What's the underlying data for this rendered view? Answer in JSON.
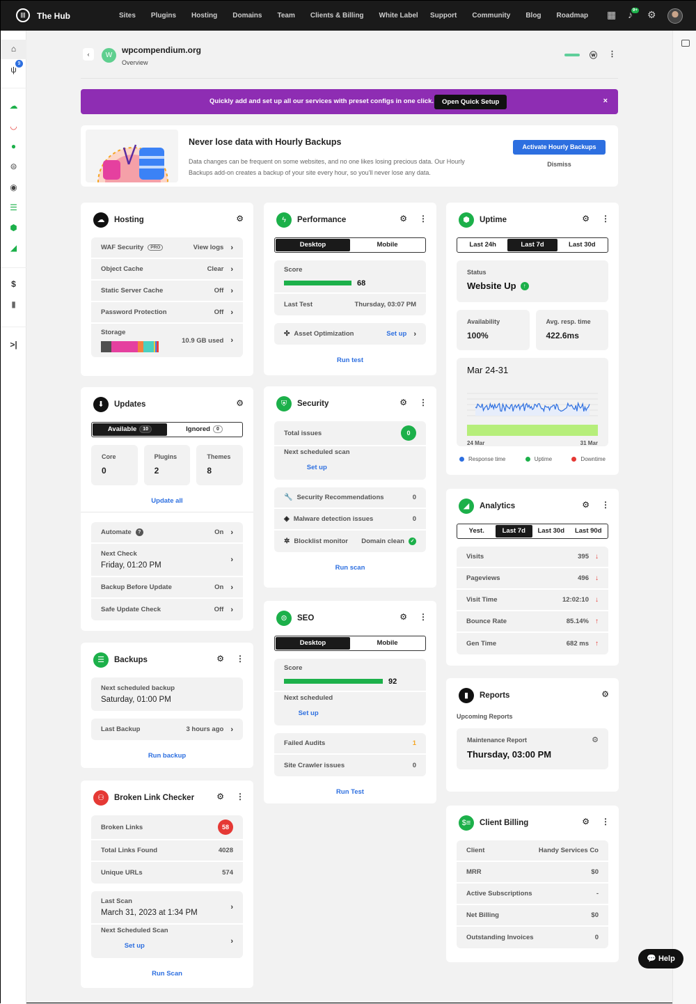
{
  "topnav": {
    "brand": "The Hub",
    "items": [
      "Sites",
      "Plugins",
      "Hosting",
      "Domains",
      "Team",
      "Clients & Billing",
      "White Label"
    ],
    "items_right": [
      "Support",
      "Community",
      "Blog",
      "Roadmap"
    ],
    "notification_count": "9+"
  },
  "sidebar": {
    "plugins_badge": "9"
  },
  "site": {
    "avatar_letter": "W",
    "name": "wpcompendium.org",
    "subtitle": "Overview"
  },
  "banner": {
    "text": "Quickly add and set up all our services with preset configs in one click.",
    "button": "Open Quick Setup",
    "close": "×",
    "color": "#8e2db3"
  },
  "promo": {
    "title": "Never lose data with Hourly Backups",
    "description": "Data changes can be frequent on some websites, and no one likes losing precious data. Our Hourly Backups add-on creates a backup of your site every hour, so you'll never lose any data.",
    "button": "Activate Hourly Backups",
    "dismiss": "Dismiss"
  },
  "columns": [
    {
      "cards": [
        {
          "title": "Hosting",
          "icon": "cloud-icon",
          "icon_color": "#111111",
          "gear": true,
          "more": false,
          "sections": [
            {
              "type": "rows",
              "rows": [
                {
                  "label": "WAF Security",
                  "pro": "PRO",
                  "value": "View logs",
                  "chevron": true
                },
                {
                  "label": "Object Cache",
                  "value": "Clear",
                  "chevron": true
                },
                {
                  "label": "Static Server Cache",
                  "value": "Off",
                  "chevron": true
                },
                {
                  "label": "Password Protection",
                  "value": "Off",
                  "chevron": true
                },
                {
                  "label": "Storage",
                  "value": "10.9 GB used",
                  "chevron": true,
                  "storage": [
                    {
                      "color": "#4f4f4f",
                      "pct": 18
                    },
                    {
                      "color": "#e5409f",
                      "pct": 46
                    },
                    {
                      "color": "#f5803e",
                      "pct": 9
                    },
                    {
                      "color": "#4ad0c0",
                      "pct": 19
                    },
                    {
                      "color": "#f0c93a",
                      "pct": 2
                    },
                    {
                      "color": "#3b82f6",
                      "pct": 2
                    },
                    {
                      "color": "#e94040",
                      "pct": 4
                    }
                  ]
                }
              ]
            }
          ]
        },
        {
          "title": "Updates",
          "icon": "updates-icon",
          "icon_color": "#111111",
          "gear": true,
          "more": false,
          "sections": [
            {
              "type": "tabs",
              "active": 0,
              "items": [
                {
                  "label": "Available",
                  "badge": "10"
                },
                {
                  "label": "Ignored",
                  "badge": "0"
                }
              ]
            },
            {
              "type": "tiles",
              "items": [
                {
                  "label": "Core",
                  "value": "0"
                },
                {
                  "label": "Plugins",
                  "value": "2"
                },
                {
                  "label": "Themes",
                  "value": "8"
                }
              ]
            },
            {
              "type": "link",
              "text": "Update all"
            },
            {
              "type": "divider"
            },
            {
              "type": "rows",
              "rows": [
                {
                  "label": "Automate",
                  "help": true,
                  "value": "On",
                  "chevron": true
                },
                {
                  "label": "Next Check",
                  "sub": "Friday, 01:20 PM",
                  "chevron": true
                },
                {
                  "label": "Backup Before Update",
                  "value": "On",
                  "chevron": true
                },
                {
                  "label": "Safe Update Check",
                  "value": "Off",
                  "chevron": true
                }
              ]
            }
          ]
        },
        {
          "title": "Backups",
          "icon": "backups-icon",
          "icon_color": "#1cb04a",
          "gear": true,
          "more": true,
          "sections": [
            {
              "type": "rows",
              "rows": [
                {
                  "label": "Next scheduled backup",
                  "sub": "Saturday, 01:00 PM"
                }
              ]
            },
            {
              "type": "rows",
              "rows": [
                {
                  "label": "Last Backup",
                  "value": "3 hours ago",
                  "chevron": true
                }
              ]
            },
            {
              "type": "link",
              "text": "Run backup"
            }
          ]
        },
        {
          "title": "Broken Link Checker",
          "icon": "broken-link-icon",
          "icon_color": "#e53935",
          "gear": true,
          "more": true,
          "sections": [
            {
              "type": "rows",
              "rows": [
                {
                  "label": "Broken Links",
                  "value_badge": "58",
                  "badge_color": "#e53935"
                },
                {
                  "label": "Total Links Found",
                  "value": "4028"
                },
                {
                  "label": "Unique URLs",
                  "value": "574"
                }
              ]
            },
            {
              "type": "rows",
              "rows": [
                {
                  "label": "Last Scan",
                  "sub": "March 31, 2023 at 1:34 PM",
                  "chevron": true
                },
                {
                  "label": "Next Scheduled Scan",
                  "sub": "Set up",
                  "sub_link": true,
                  "chevron": true
                }
              ]
            },
            {
              "type": "link",
              "text": "Run Scan"
            }
          ]
        }
      ]
    },
    {
      "cards": [
        {
          "title": "Performance",
          "icon": "lightning-icon",
          "icon_color": "#1cb04a",
          "gear": true,
          "more": true,
          "sections": [
            {
              "type": "tabs",
              "active": 0,
              "items": [
                {
                  "label": "Desktop"
                },
                {
                  "label": "Mobile"
                }
              ]
            },
            {
              "type": "rows",
              "rows": [
                {
                  "label": "Score",
                  "score": 68
                },
                {
                  "label": "Last Test",
                  "value": "Thursday, 03:07 PM"
                }
              ]
            },
            {
              "type": "rows",
              "rows": [
                {
                  "label": "Asset Optimization",
                  "icon": "compress-icon",
                  "value": "Set up",
                  "value_link": true,
                  "chevron": true
                }
              ]
            },
            {
              "type": "link",
              "text": "Run test"
            }
          ]
        },
        {
          "title": "Security",
          "icon": "shield-icon",
          "icon_color": "#1cb04a",
          "gear": true,
          "more": true,
          "sections": [
            {
              "type": "rows",
              "rows": [
                {
                  "label": "Total issues",
                  "value_badge": "0",
                  "badge_color": "#1cb04a"
                },
                {
                  "label": "Next scheduled scan",
                  "sub": "Set up",
                  "sub_link": true
                }
              ]
            },
            {
              "type": "rows",
              "rows": [
                {
                  "label": "Security Recommendations",
                  "icon": "wrench-icon",
                  "value": "0"
                },
                {
                  "label": "Malware detection issues",
                  "icon": "layers-icon",
                  "value": "0"
                },
                {
                  "label": "Blocklist monitor",
                  "icon": "bug-icon",
                  "value": "Domain clean",
                  "check": true
                }
              ]
            },
            {
              "type": "link",
              "text": "Run scan"
            }
          ]
        },
        {
          "title": "SEO",
          "icon": "seo-icon",
          "icon_color": "#1cb04a",
          "gear": true,
          "more": true,
          "sections": [
            {
              "type": "tabs",
              "active": 0,
              "items": [
                {
                  "label": "Desktop"
                },
                {
                  "label": "Mobile"
                }
              ]
            },
            {
              "type": "rows",
              "rows": [
                {
                  "label": "Score",
                  "score": 92
                },
                {
                  "label": "Next scheduled",
                  "sub": "Set up",
                  "sub_link": true
                }
              ]
            },
            {
              "type": "rows",
              "rows": [
                {
                  "label": "Failed Audits",
                  "value": "1",
                  "value_color": "#f5a623"
                },
                {
                  "label": "Site Crawler issues",
                  "value": "0"
                }
              ]
            },
            {
              "type": "link",
              "text": "Run Test"
            }
          ]
        }
      ]
    },
    {
      "cards": [
        {
          "title": "Uptime",
          "icon": "uptime-icon",
          "icon_color": "#1cb04a",
          "gear": true,
          "more": true,
          "sections": [
            {
              "type": "tabs",
              "active": 1,
              "items": [
                {
                  "label": "Last 24h"
                },
                {
                  "label": "Last 7d"
                },
                {
                  "label": "Last 30d"
                }
              ]
            },
            {
              "type": "status",
              "label": "Status",
              "value": "Website Up"
            },
            {
              "type": "tiles",
              "items": [
                {
                  "label": "Availability",
                  "value": "100%"
                },
                {
                  "label": "Avg. resp. time",
                  "value": "422.6ms"
                }
              ]
            },
            {
              "type": "chart",
              "title": "Mar 24-31",
              "x_start": "24 Mar",
              "x_end": "31 Mar",
              "line_color": "#2d6fe0",
              "uptime_color": "#b6ee7a"
            },
            {
              "type": "legend",
              "items": [
                {
                  "label": "Response time",
                  "color": "#2d6fe0"
                },
                {
                  "label": "Uptime",
                  "color": "#1cb04a"
                },
                {
                  "label": "Downtime",
                  "color": "#e53935"
                }
              ]
            }
          ]
        },
        {
          "title": "Analytics",
          "icon": "analytics-icon",
          "icon_color": "#1cb04a",
          "gear": true,
          "more": true,
          "sections": [
            {
              "type": "tabs",
              "active": 1,
              "items": [
                {
                  "label": "Yest."
                },
                {
                  "label": "Last 7d"
                },
                {
                  "label": "Last 30d"
                },
                {
                  "label": "Last 90d"
                }
              ]
            },
            {
              "type": "rows",
              "rows": [
                {
                  "label": "Visits",
                  "value": "395",
                  "arrow": "down"
                },
                {
                  "label": "Pageviews",
                  "value": "496",
                  "arrow": "down"
                },
                {
                  "label": "Visit Time",
                  "value": "12:02:10",
                  "arrow": "down"
                },
                {
                  "label": "Bounce Rate",
                  "value": "85.14%",
                  "arrow": "up"
                },
                {
                  "label": "Gen Time",
                  "value": "682 ms",
                  "arrow": "up"
                }
              ]
            }
          ]
        },
        {
          "title": "Reports",
          "icon": "reports-icon",
          "icon_color": "#111111",
          "gear": true,
          "more": false,
          "sections": [
            {
              "type": "heading",
              "text": "Upcoming Reports"
            },
            {
              "type": "report",
              "label": "Maintenance Report",
              "value": "Thursday, 03:00 PM"
            }
          ]
        },
        {
          "title": "Client Billing",
          "icon": "billing-icon",
          "icon_color": "#1cb04a",
          "gear": true,
          "more": true,
          "sections": [
            {
              "type": "rows",
              "rows": [
                {
                  "label": "Client",
                  "value": "Handy Services Co"
                },
                {
                  "label": "MRR",
                  "value": "$0"
                },
                {
                  "label": "Active Subscriptions",
                  "value": "-"
                },
                {
                  "label": "Net Billing",
                  "value": "$0"
                },
                {
                  "label": "Outstanding Invoices",
                  "value": "0"
                }
              ]
            }
          ]
        }
      ]
    }
  ],
  "help_button": "Help"
}
